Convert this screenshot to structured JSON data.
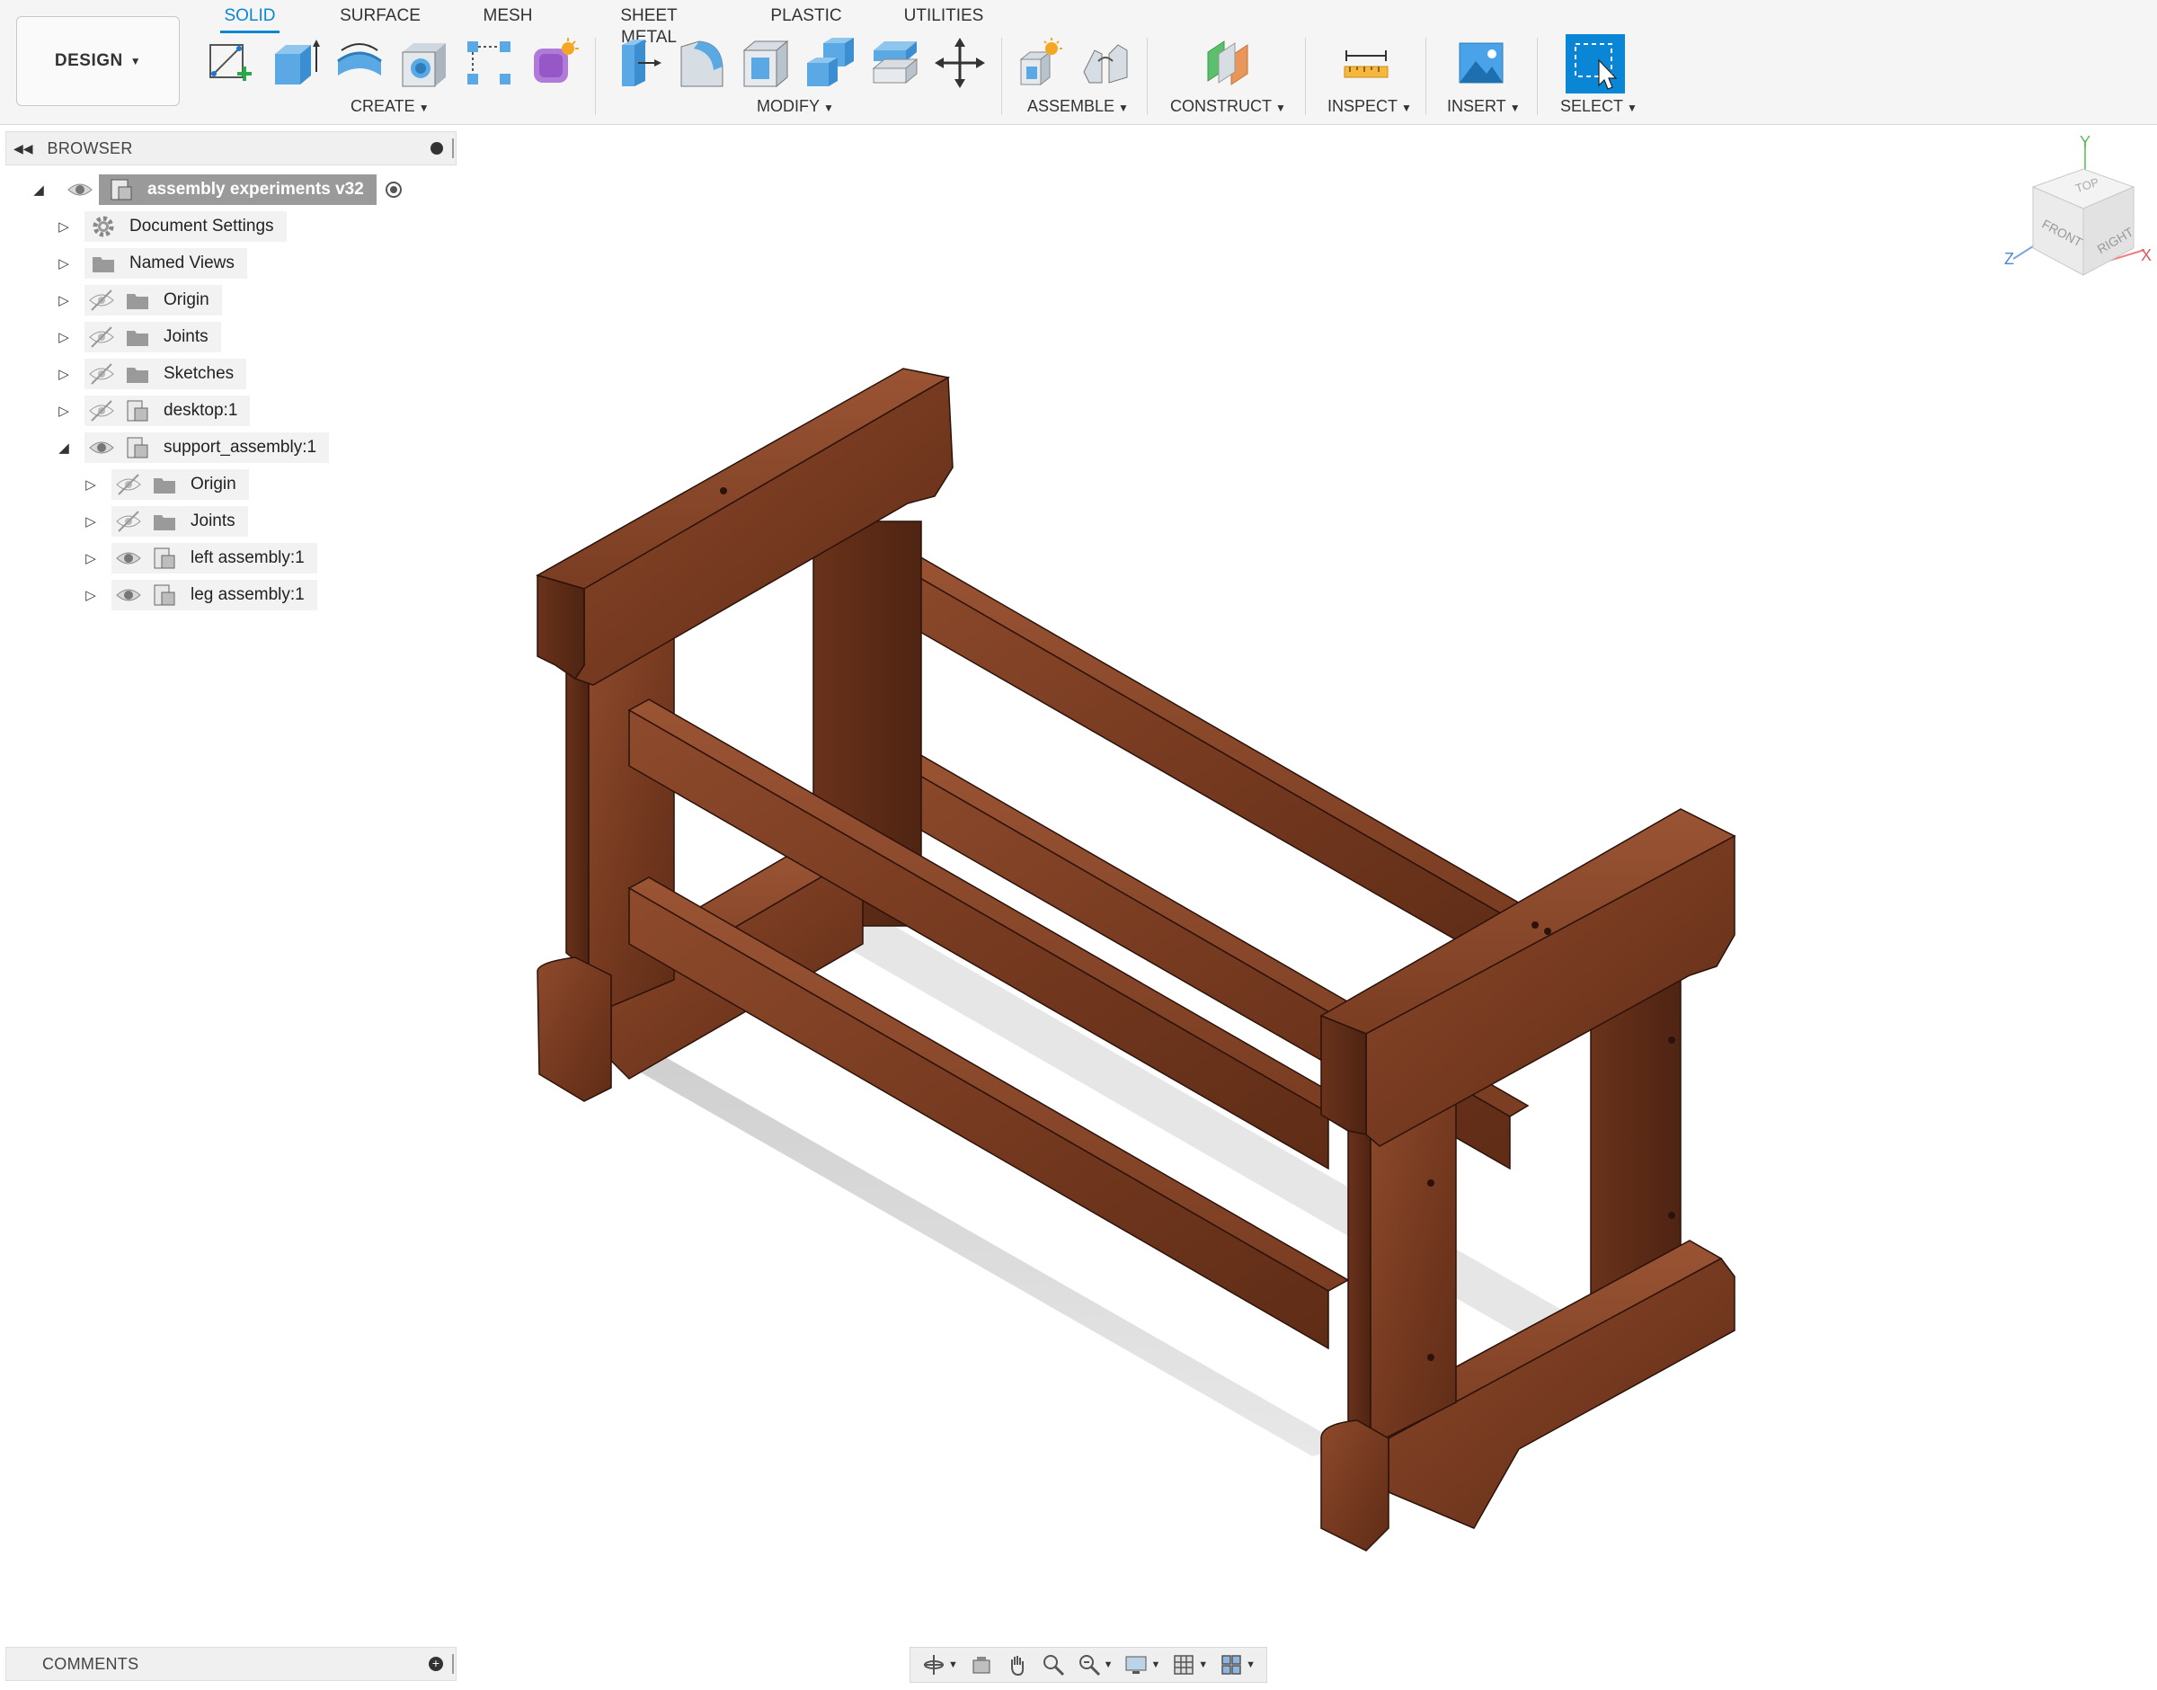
{
  "toolbar": {
    "workspace_button": "DESIGN",
    "tabs": [
      "SOLID",
      "SURFACE",
      "MESH",
      "SHEET METAL",
      "PLASTIC",
      "UTILITIES"
    ],
    "active_tab": "SOLID",
    "groups": {
      "create": "CREATE",
      "modify": "MODIFY",
      "assemble": "ASSEMBLE",
      "construct": "CONSTRUCT",
      "inspect": "INSPECT",
      "insert": "INSERT",
      "select": "SELECT"
    }
  },
  "browser": {
    "title": "BROWSER",
    "root": "assembly experiments v32",
    "items": [
      {
        "label": "Document Settings"
      },
      {
        "label": "Named Views"
      },
      {
        "label": "Origin"
      },
      {
        "label": "Joints"
      },
      {
        "label": "Sketches"
      },
      {
        "label": "desktop:1"
      },
      {
        "label": "support_assembly:1"
      },
      {
        "label": "Origin"
      },
      {
        "label": "Joints"
      },
      {
        "label": "left assembly:1"
      },
      {
        "label": "leg assembly:1"
      }
    ]
  },
  "comments": {
    "title": "COMMENTS"
  },
  "viewcube": {
    "faces": {
      "top": "TOP",
      "front": "FRONT",
      "right": "RIGHT"
    },
    "axes": {
      "x": "X",
      "y": "Y",
      "z": "Z"
    }
  },
  "colors": {
    "accent": "#0a86d6",
    "wood": "#7a3b22",
    "wood_dark": "#5a2a17",
    "wood_light": "#8e4a2c"
  },
  "icons": {
    "nav": [
      "orbit-icon",
      "look-at-icon",
      "pan-icon",
      "zoom-icon",
      "fit-icon",
      "display-settings-icon",
      "grid-icon",
      "viewports-icon"
    ]
  }
}
